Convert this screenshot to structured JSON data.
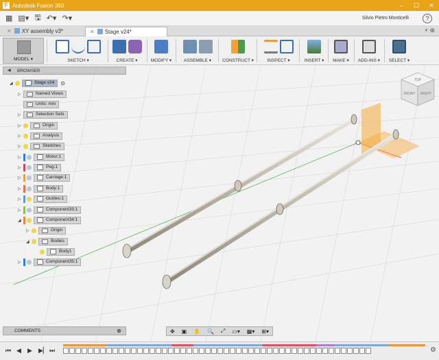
{
  "window": {
    "title": "Autodesk Fusion 360"
  },
  "user": {
    "name": "Silvio Pietro Monticelli",
    "help": "?"
  },
  "tabs": [
    {
      "label": "XY assembly v3*"
    },
    {
      "label": "Stage v24*"
    }
  ],
  "ribbon": {
    "workspace": "MODEL",
    "groups": [
      "SKETCH",
      "CREATE",
      "MODIFY",
      "ASSEMBLE",
      "CONSTRUCT",
      "INSPECT",
      "INSERT",
      "MAKE",
      "ADD-INS",
      "SELECT"
    ]
  },
  "browser": {
    "header": "BROWSER",
    "root": "Stage v24",
    "items": [
      "Named Views",
      "Units: mm",
      "Selection Sets",
      "Origin",
      "Analysis",
      "Sketches",
      "Motor:1",
      "Peg:1",
      "Carriage:1",
      "Body:1",
      "Guides:1",
      "Component33:1",
      "Component34:1",
      "Origin",
      "Bodies",
      "Body1",
      "Component35:1"
    ]
  },
  "viewcube": {
    "top": "TOP",
    "front": "FRONT",
    "right": "RIGHT"
  },
  "comments": {
    "label": "COMMENTS"
  },
  "colors": {
    "titlebar": "#e8a317",
    "accent": "#f2a23a",
    "plane": "#f7a93a",
    "selected": "#4a6f8f"
  }
}
